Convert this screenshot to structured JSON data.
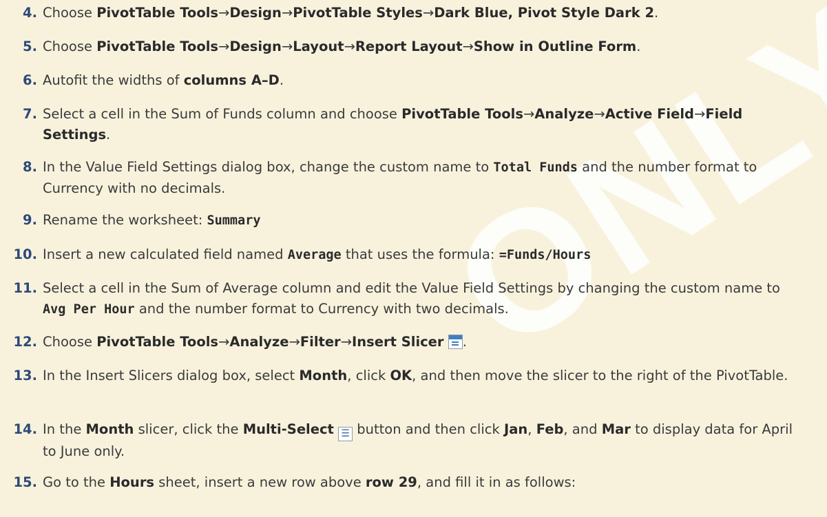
{
  "watermark": "ONLY",
  "arrow": "→",
  "steps": {
    "s4": {
      "num": "4.",
      "t1": "Choose ",
      "b1": "PivotTable Tools",
      "b2": "Design",
      "b3": "PivotTable Styles",
      "b4": "Dark Blue, Pivot Style Dark 2",
      "end": "."
    },
    "s5": {
      "num": "5.",
      "t1": "Choose ",
      "b1": "PivotTable Tools",
      "b2": "Design",
      "b3": "Layout",
      "b4": "Report Layout",
      "b5": "Show in Outline Form",
      "end": "."
    },
    "s6": {
      "num": "6.",
      "t1": "Autofit the widths of ",
      "b1": "columns A–D",
      "end": "."
    },
    "s7": {
      "num": "7.",
      "t1": "Select a cell in the Sum of Funds column and choose ",
      "b1": "PivotTable Tools",
      "b2": "Analyze",
      "b3": "Active Field",
      "b4": "Field Settings",
      "end": "."
    },
    "s8": {
      "num": "8.",
      "t1": "In the Value Field Settings dialog box, change the custom name to ",
      "m1": "Total Funds",
      "t2": " and the number format to Currency with no decimals."
    },
    "s9": {
      "num": "9.",
      "t1": "Rename the worksheet: ",
      "m1": "Summary"
    },
    "s10": {
      "num": "10.",
      "t1": "Insert a new calculated field named ",
      "m1": "Average",
      "t2": " that uses the formula: ",
      "m2": "=Funds/Hours"
    },
    "s11": {
      "num": "11.",
      "t1": "Select a cell in the Sum of Average column and edit the Value Field Settings by changing the custom name to ",
      "m1": "Avg Per Hour",
      "t2": " and the number format to Currency with two decimals."
    },
    "s12": {
      "num": "12.",
      "t1": "Choose ",
      "b1": "PivotTable Tools",
      "b2": "Analyze",
      "b3": "Filter",
      "b4": "Insert Slicer",
      "end": "."
    },
    "s13": {
      "num": "13.",
      "t1": "In the Insert Slicers dialog box, select ",
      "b1": "Month",
      "t2": ", click ",
      "b2": "OK",
      "t3": ", and then move the slicer to the right of the PivotTable."
    },
    "s14": {
      "num": "14.",
      "t1": "In the ",
      "b1": "Month",
      "t2": " slicer, click the ",
      "b2": "Multi-Select",
      "t3": " button and then click ",
      "b3": "Jan",
      "t4": ", ",
      "b4": "Feb",
      "t5": ", and ",
      "b5": "Mar",
      "t6": " to display data for April to June only."
    },
    "s15": {
      "num": "15.",
      "t1": "Go to the ",
      "b1": "Hours",
      "t2": " sheet, insert a new row above ",
      "b2": "row 29",
      "t3": ", and fill it in as follows:"
    }
  },
  "icons": {
    "slicer": "insert-slicer-icon",
    "multi_select": "multi-select-icon",
    "multi_select_glyph": "☰"
  }
}
